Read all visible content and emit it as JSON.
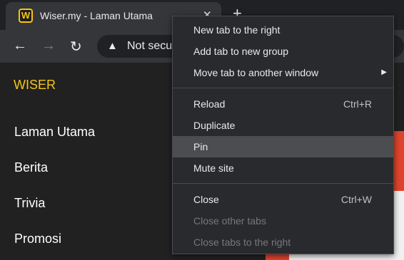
{
  "tab": {
    "title": "Wiser.my - Laman Utama",
    "favicon_letter": "W",
    "close": "✕"
  },
  "new_tab": "+",
  "toolbar": {
    "back": "←",
    "forward": "→",
    "reload": "↻"
  },
  "omnibox": {
    "warning": "▲",
    "text": "Not secu"
  },
  "page": {
    "brand": "WISER",
    "nav": [
      "Laman Utama",
      "Berita",
      "Trivia",
      "Promosi"
    ]
  },
  "menu": {
    "group1": [
      {
        "label": "New tab to the right"
      },
      {
        "label": "Add tab to new group"
      },
      {
        "label": "Move tab to another window",
        "submenu_arrow": "▶"
      }
    ],
    "group2": [
      {
        "label": "Reload",
        "shortcut": "Ctrl+R"
      },
      {
        "label": "Duplicate"
      },
      {
        "label": "Pin"
      },
      {
        "label": "Mute site"
      }
    ],
    "group3": [
      {
        "label": "Close",
        "shortcut": "Ctrl+W"
      },
      {
        "label": "Close other tabs"
      },
      {
        "label": "Close tabs to the right"
      }
    ]
  },
  "colors": {
    "brand": "#f5c518",
    "menu_bg": "#292a2d",
    "menu_highlight": "#4c4d51",
    "hero_red": "#e0442c"
  }
}
